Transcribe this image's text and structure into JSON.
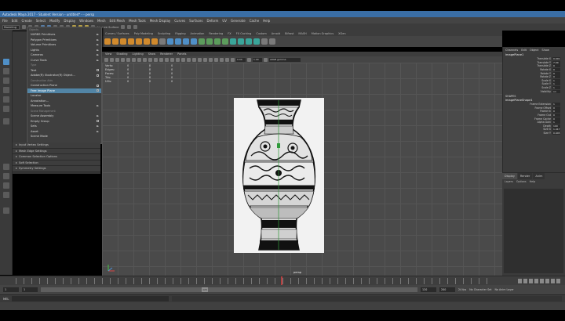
{
  "title": "Autodesk Maya 2017 - Student Version - untitled* - - persp",
  "menubar": [
    "File",
    "Edit",
    "Create",
    "Select",
    "Modify",
    "Display",
    "Windows",
    "Mesh",
    "Edit Mesh",
    "Mesh Tools",
    "Mesh Display",
    "Curves",
    "Surfaces",
    "Deform",
    "UV",
    "Generate",
    "Cache",
    "Help"
  ],
  "status_line": {
    "mode": "Modeling",
    "no_live_surface": "No Live Surface"
  },
  "shelf_tabs": [
    "Curves / Surfaces",
    "Poly Modeling",
    "Sculpting",
    "Rigging",
    "Animation",
    "Rendering",
    "FX",
    "FX Caching",
    "Custom",
    "Arnold",
    "Bifrost",
    "MASH",
    "Motion Graphics",
    "XGen"
  ],
  "create_menu": {
    "header": "Objects",
    "items": [
      {
        "label": "NURBS Primitives",
        "arrow": "►",
        "type": "item"
      },
      {
        "label": "Polygon Primitives",
        "arrow": "►",
        "type": "item"
      },
      {
        "label": "Volume Primitives",
        "arrow": "►",
        "type": "item"
      },
      {
        "label": "Lights",
        "arrow": "►",
        "type": "item"
      },
      {
        "label": "Cameras",
        "arrow": "►",
        "type": "item"
      },
      {
        "label": "Curve Tools",
        "arrow": "►",
        "type": "item"
      },
      {
        "label": "Type",
        "arrow": "",
        "type": "section"
      },
      {
        "label": "Text",
        "arrow": "",
        "type": "item",
        "box": true
      },
      {
        "label": "Adobe(R) Illustrator(R) Object...",
        "arrow": "",
        "type": "item",
        "box": true
      },
      {
        "label": "Construction Aids",
        "arrow": "",
        "type": "section"
      },
      {
        "label": "Construction Plane",
        "arrow": "",
        "type": "item",
        "box": true
      },
      {
        "label": "Free Image Plane",
        "arrow": "",
        "type": "item",
        "box": true,
        "highlight": true
      },
      {
        "label": "Locator",
        "arrow": "",
        "type": "item"
      },
      {
        "label": "Annotation...",
        "arrow": "",
        "type": "item"
      },
      {
        "label": "Measure Tools",
        "arrow": "►",
        "type": "item"
      },
      {
        "label": "Scene Management",
        "arrow": "",
        "type": "section"
      },
      {
        "label": "Scene Assembly",
        "arrow": "►",
        "type": "item"
      },
      {
        "label": "Empty Group",
        "arrow": "",
        "type": "item",
        "box": true
      },
      {
        "label": "Sets",
        "arrow": "►",
        "type": "item"
      },
      {
        "label": "Asset",
        "arrow": "►",
        "type": "item"
      },
      {
        "label": "Scene Mode",
        "arrow": "",
        "type": "item"
      }
    ]
  },
  "outliner_rows": [
    "Input Vertex Settings",
    "Mesh Edge Settings",
    "Common Selection Options",
    "Soft Selection",
    "Symmetry Settings"
  ],
  "viewport": {
    "menus": [
      "View",
      "Shading",
      "Lighting",
      "Show",
      "Renderer",
      "Panels"
    ],
    "toolbar_fields": [
      "0.00",
      "1.00"
    ],
    "color_space": "sRGB gamma",
    "hud": [
      [
        "Verts:",
        "0",
        "0",
        "0"
      ],
      [
        "Edges:",
        "0",
        "0",
        "0"
      ],
      [
        "Faces:",
        "0",
        "0",
        "0"
      ],
      [
        "Tris:",
        "0",
        "0",
        "0"
      ],
      [
        "UVs:",
        "0",
        "0",
        "0"
      ]
    ],
    "camera_label": "persp"
  },
  "channel_box": {
    "tabs": [
      "Channels",
      "Edit",
      "Object",
      "Show"
    ],
    "node": "imagePlane1",
    "attrs": [
      {
        "name": "Translate X",
        "value": "0.001"
      },
      {
        "name": "Translate Y",
        "value": "7.09"
      },
      {
        "name": "Translate Z",
        "value": "0"
      },
      {
        "name": "Rotate X",
        "value": "0"
      },
      {
        "name": "Rotate Y",
        "value": "0"
      },
      {
        "name": "Rotate Z",
        "value": "0"
      },
      {
        "name": "Scale X",
        "value": "1"
      },
      {
        "name": "Scale Y",
        "value": "1"
      },
      {
        "name": "Scale Z",
        "value": "1"
      },
      {
        "name": "Visibility",
        "value": "on"
      }
    ],
    "shapes_header": "SHAPES",
    "shape_node": "imagePlaneShape1",
    "shape_attrs": [
      {
        "name": "Frame Extension",
        "value": "1"
      },
      {
        "name": "Frame Offset",
        "value": "0"
      },
      {
        "name": "Frame In",
        "value": "0"
      },
      {
        "name": "Frame Out",
        "value": "0"
      },
      {
        "name": "Frame Cache",
        "value": "0"
      },
      {
        "name": "Alpha Gain",
        "value": "1"
      },
      {
        "name": "Depth",
        "value": "100"
      },
      {
        "name": "Size X",
        "value": "1.417"
      },
      {
        "name": "Size Y",
        "value": "0.945"
      }
    ]
  },
  "layer_editor": {
    "tabs": [
      "Display",
      "Render",
      "Anim"
    ],
    "menus": [
      "Layers",
      "Options",
      "Help"
    ]
  },
  "time_slider": {
    "current_frame": "120"
  },
  "range_slider": {
    "start": "1",
    "start2": "1",
    "range_label": "120",
    "end": "120",
    "end2": "200",
    "fps": "24 fps",
    "no_char_set": "No Character Set",
    "no_anim_layer": "No Anim Layer"
  },
  "command_line": {
    "label": "MEL"
  }
}
